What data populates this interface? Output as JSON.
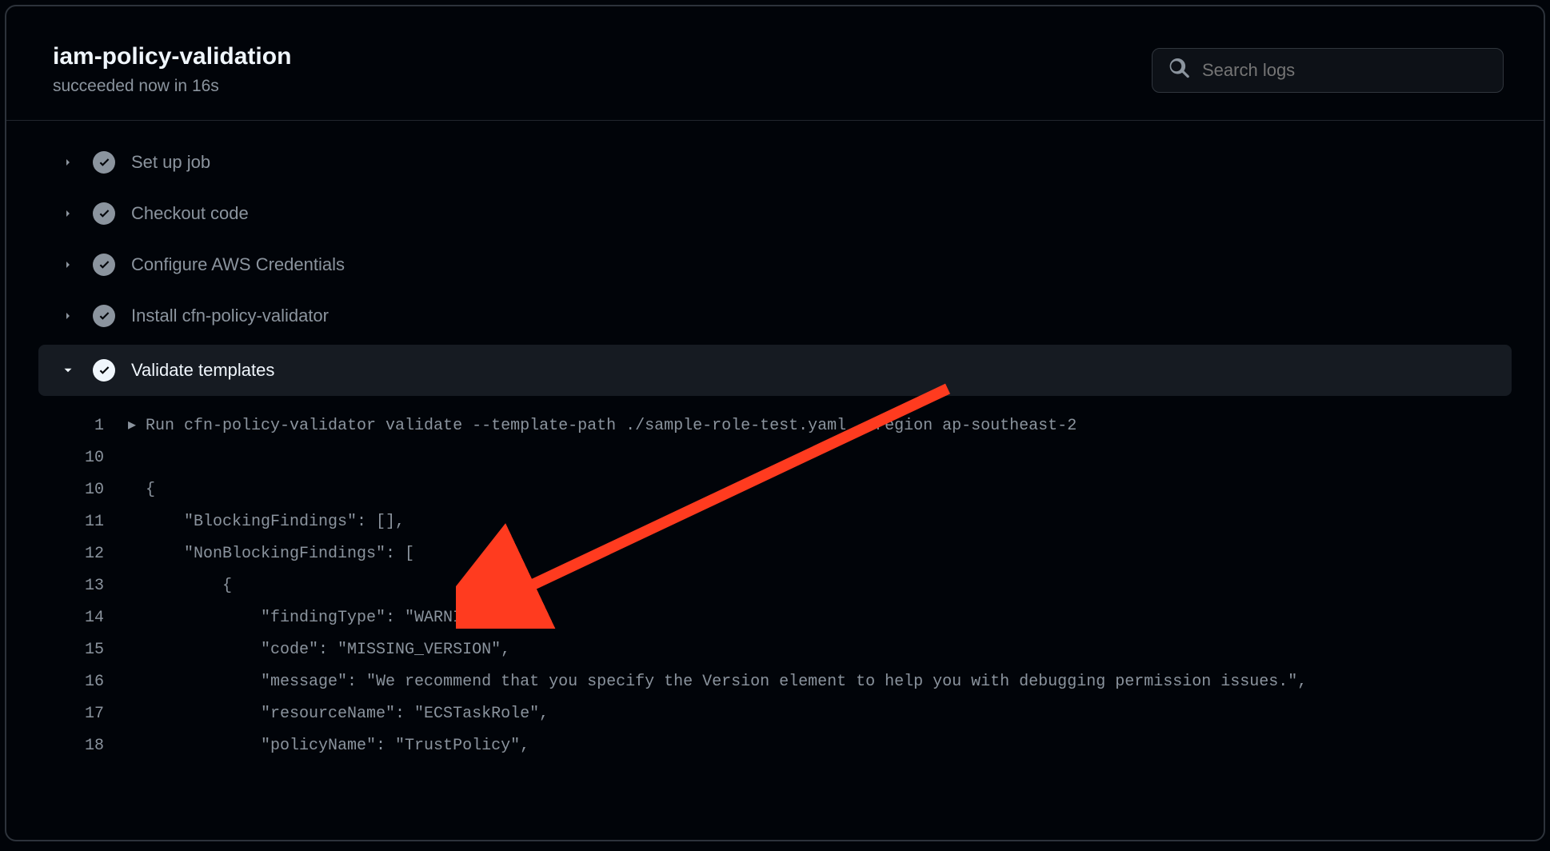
{
  "header": {
    "title": "iam-policy-validation",
    "subtitle": "succeeded now in 16s",
    "search_placeholder": "Search logs"
  },
  "steps": [
    {
      "label": "Set up job",
      "expanded": false
    },
    {
      "label": "Checkout code",
      "expanded": false
    },
    {
      "label": "Configure AWS Credentials",
      "expanded": false
    },
    {
      "label": "Install cfn-policy-validator",
      "expanded": false
    },
    {
      "label": "Validate templates",
      "expanded": true
    }
  ],
  "log": [
    {
      "n": "1",
      "caret": "▸",
      "text": "Run cfn-policy-validator validate --template-path ./sample-role-test.yaml --region ap-southeast-2"
    },
    {
      "n": "10",
      "caret": "",
      "text": ""
    },
    {
      "n": "10",
      "caret": "",
      "text": "{"
    },
    {
      "n": "11",
      "caret": "",
      "text": "    \"BlockingFindings\": [],"
    },
    {
      "n": "12",
      "caret": "",
      "text": "    \"NonBlockingFindings\": ["
    },
    {
      "n": "13",
      "caret": "",
      "text": "        {"
    },
    {
      "n": "14",
      "caret": "",
      "text": "            \"findingType\": \"WARNING\","
    },
    {
      "n": "15",
      "caret": "",
      "text": "            \"code\": \"MISSING_VERSION\","
    },
    {
      "n": "16",
      "caret": "",
      "text": "            \"message\": \"We recommend that you specify the Version element to help you with debugging permission issues.\","
    },
    {
      "n": "17",
      "caret": "",
      "text": "            \"resourceName\": \"ECSTaskRole\","
    },
    {
      "n": "18",
      "caret": "",
      "text": "            \"policyName\": \"TrustPolicy\","
    }
  ]
}
